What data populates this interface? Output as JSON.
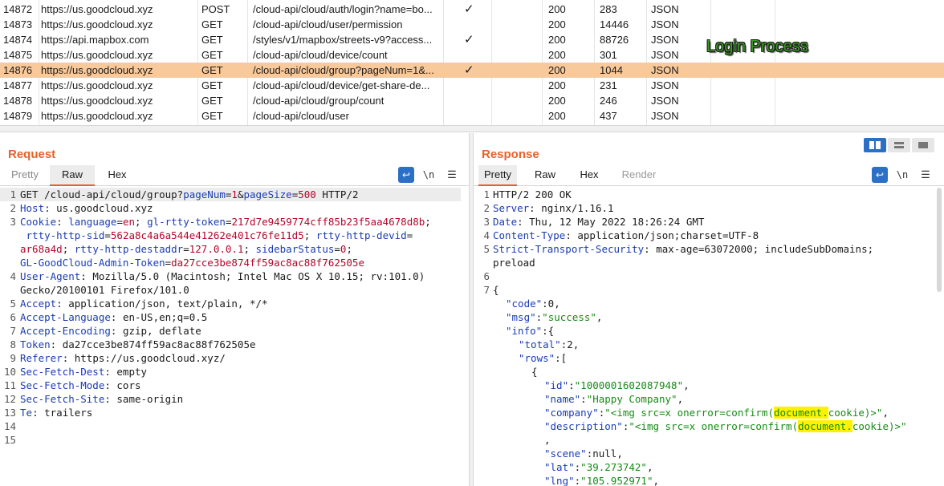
{
  "history": {
    "rows": [
      {
        "id": "14872",
        "host": "https://us.goodcloud.xyz",
        "method": "POST",
        "url": "/cloud-api/cloud/auth/login?name=bo...",
        "check": "✓",
        "status": "200",
        "length": "283",
        "mime": "JSON"
      },
      {
        "id": "14873",
        "host": "https://us.goodcloud.xyz",
        "method": "GET",
        "url": "/cloud-api/cloud/user/permission",
        "check": "",
        "status": "200",
        "length": "14446",
        "mime": "JSON"
      },
      {
        "id": "14874",
        "host": "https://api.mapbox.com",
        "method": "GET",
        "url": "/styles/v1/mapbox/streets-v9?access...",
        "check": "✓",
        "status": "200",
        "length": "88726",
        "mime": "JSON"
      },
      {
        "id": "14875",
        "host": "https://us.goodcloud.xyz",
        "method": "GET",
        "url": "/cloud-api/cloud/device/count",
        "check": "",
        "status": "200",
        "length": "301",
        "mime": "JSON"
      },
      {
        "id": "14876",
        "host": "https://us.goodcloud.xyz",
        "method": "GET",
        "url": "/cloud-api/cloud/group?pageNum=1&...",
        "check": "✓",
        "status": "200",
        "length": "1044",
        "mime": "JSON"
      },
      {
        "id": "14877",
        "host": "https://us.goodcloud.xyz",
        "method": "GET",
        "url": "/cloud-api/cloud/device/get-share-de...",
        "check": "",
        "status": "200",
        "length": "231",
        "mime": "JSON"
      },
      {
        "id": "14878",
        "host": "https://us.goodcloud.xyz",
        "method": "GET",
        "url": "/cloud-api/cloud/group/count",
        "check": "",
        "status": "200",
        "length": "246",
        "mime": "JSON"
      },
      {
        "id": "14879",
        "host": "https://us.goodcloud.xyz",
        "method": "GET",
        "url": "/cloud-api/cloud/user",
        "check": "",
        "status": "200",
        "length": "437",
        "mime": "JSON"
      }
    ],
    "annotation": "Login Process"
  },
  "request": {
    "title": "Request",
    "tabs": [
      "Pretty",
      "Raw",
      "Hex"
    ],
    "wrap_icon": "wrap-lines-icon",
    "newline_label": "\\n",
    "menu_icon": "hamburger-menu-icon",
    "line_numbers": [
      "1",
      "2",
      "3",
      "4",
      "5",
      "6",
      "7",
      "8",
      "9",
      "10",
      "11",
      "12",
      "13",
      "14",
      "15"
    ],
    "lines": {
      "l1_method": "GET /cloud-api/cloud/group?",
      "l1_k1": "pageNum",
      "l1_eq1": "=",
      "l1_v1": "1",
      "l1_amp": "&",
      "l1_k2": "pageSize",
      "l1_eq2": "=",
      "l1_v2": "500",
      "l1_proto": " HTTP/2",
      "l2_k": "Host",
      "l2_v": ": us.goodcloud.xyz",
      "l3_k": "Cookie",
      "l3_sep": ": ",
      "c1_k": "language",
      "c1_v": "en",
      "c2_k": "gl-rtty-token",
      "c2_v": "217d7e9459774cff85b23f5aa4678d8b",
      "c3_k": "rtty-http-sid",
      "c3_v": "562a8c4a6a544e41262e401c76fe11d5",
      "c4_k": "rtty-http-devid",
      "c4_v": "ar68a4d",
      "c5_k": "rtty-http-destaddr",
      "c5_v": "127.0.0.1",
      "c6_k": "sidebarStatus",
      "c6_v": "0",
      "c7_k": "GL-GoodCloud-Admin-Token",
      "c7_v": "da27cce3be874ff59ac8ac88f762505e",
      "l4_k": "User-Agent",
      "l4_v": ": Mozilla/5.0 (Macintosh; Intel Mac OS X 10.15; rv:101.0)",
      "l4_v2": "Gecko/20100101 Firefox/101.0",
      "l5_k": "Accept",
      "l5_v": ": application/json, text/plain, */*",
      "l6_k": "Accept-Language",
      "l6_v": ": en-US,en;q=0.5",
      "l7_k": "Accept-Encoding",
      "l7_v": ": gzip, deflate",
      "l8_k": "Token",
      "l8_v": ": da27cce3be874ff59ac8ac88f762505e",
      "l9_k": "Referer",
      "l9_v": ": https://us.goodcloud.xyz/",
      "l10_k": "Sec-Fetch-Dest",
      "l10_v": ": empty",
      "l11_k": "Sec-Fetch-Mode",
      "l11_v": ": cors",
      "l12_k": "Sec-Fetch-Site",
      "l12_v": ": same-origin",
      "l13_k": "Te",
      "l13_v": ": trailers"
    }
  },
  "response": {
    "title": "Response",
    "tabs": [
      "Pretty",
      "Raw",
      "Hex",
      "Render"
    ],
    "line_numbers": [
      "1",
      "2",
      "3",
      "4",
      "5",
      "6",
      "7"
    ],
    "lines": {
      "l1": "HTTP/2 200 OK",
      "l2_k": "Server",
      "l2_v": ": nginx/1.16.1",
      "l3_k": "Date",
      "l3_v": ": Thu, 12 May 2022 18:26:24 GMT",
      "l4_k": "Content-Type",
      "l4_v": ": application/json;charset=UTF-8",
      "l5_k": "Strict-Transport-Security",
      "l5_v": ": max-age=63072000; includeSubDomains;",
      "l5_v2": "preload",
      "brace_open": "{",
      "code_k": "\"code\"",
      "code_v": ":0,",
      "msg_k": "\"msg\"",
      "msg_v": "\"success\"",
      "info_k": "\"info\"",
      "info_v": ":{",
      "total_k": "\"total\"",
      "total_v": ":2,",
      "rows_k": "\"rows\"",
      "rows_v": ":[",
      "obj_open": "{",
      "id_k": "\"id\"",
      "id_v": "\"1000001602087948\"",
      "name_k": "\"name\"",
      "name_v": "\"Happy Company\"",
      "company_k": "\"company\"",
      "company_v1": "\"<img src=x onerror=confirm(",
      "company_hl": "document.",
      "company_v2": "cookie)>\"",
      "desc_k": "\"description\"",
      "desc_v1": "\"<img src=x onerror=confirm(",
      "desc_hl": "document.",
      "desc_v2": "cookie)>\"",
      "comma": ",",
      "scene_k": "\"scene\"",
      "scene_v": ":null,",
      "lat_k": "\"lat\"",
      "lat_v": "\"39.273742\"",
      "lng_k": "\"lng\"",
      "lng_v": "\"105.952971\""
    }
  }
}
